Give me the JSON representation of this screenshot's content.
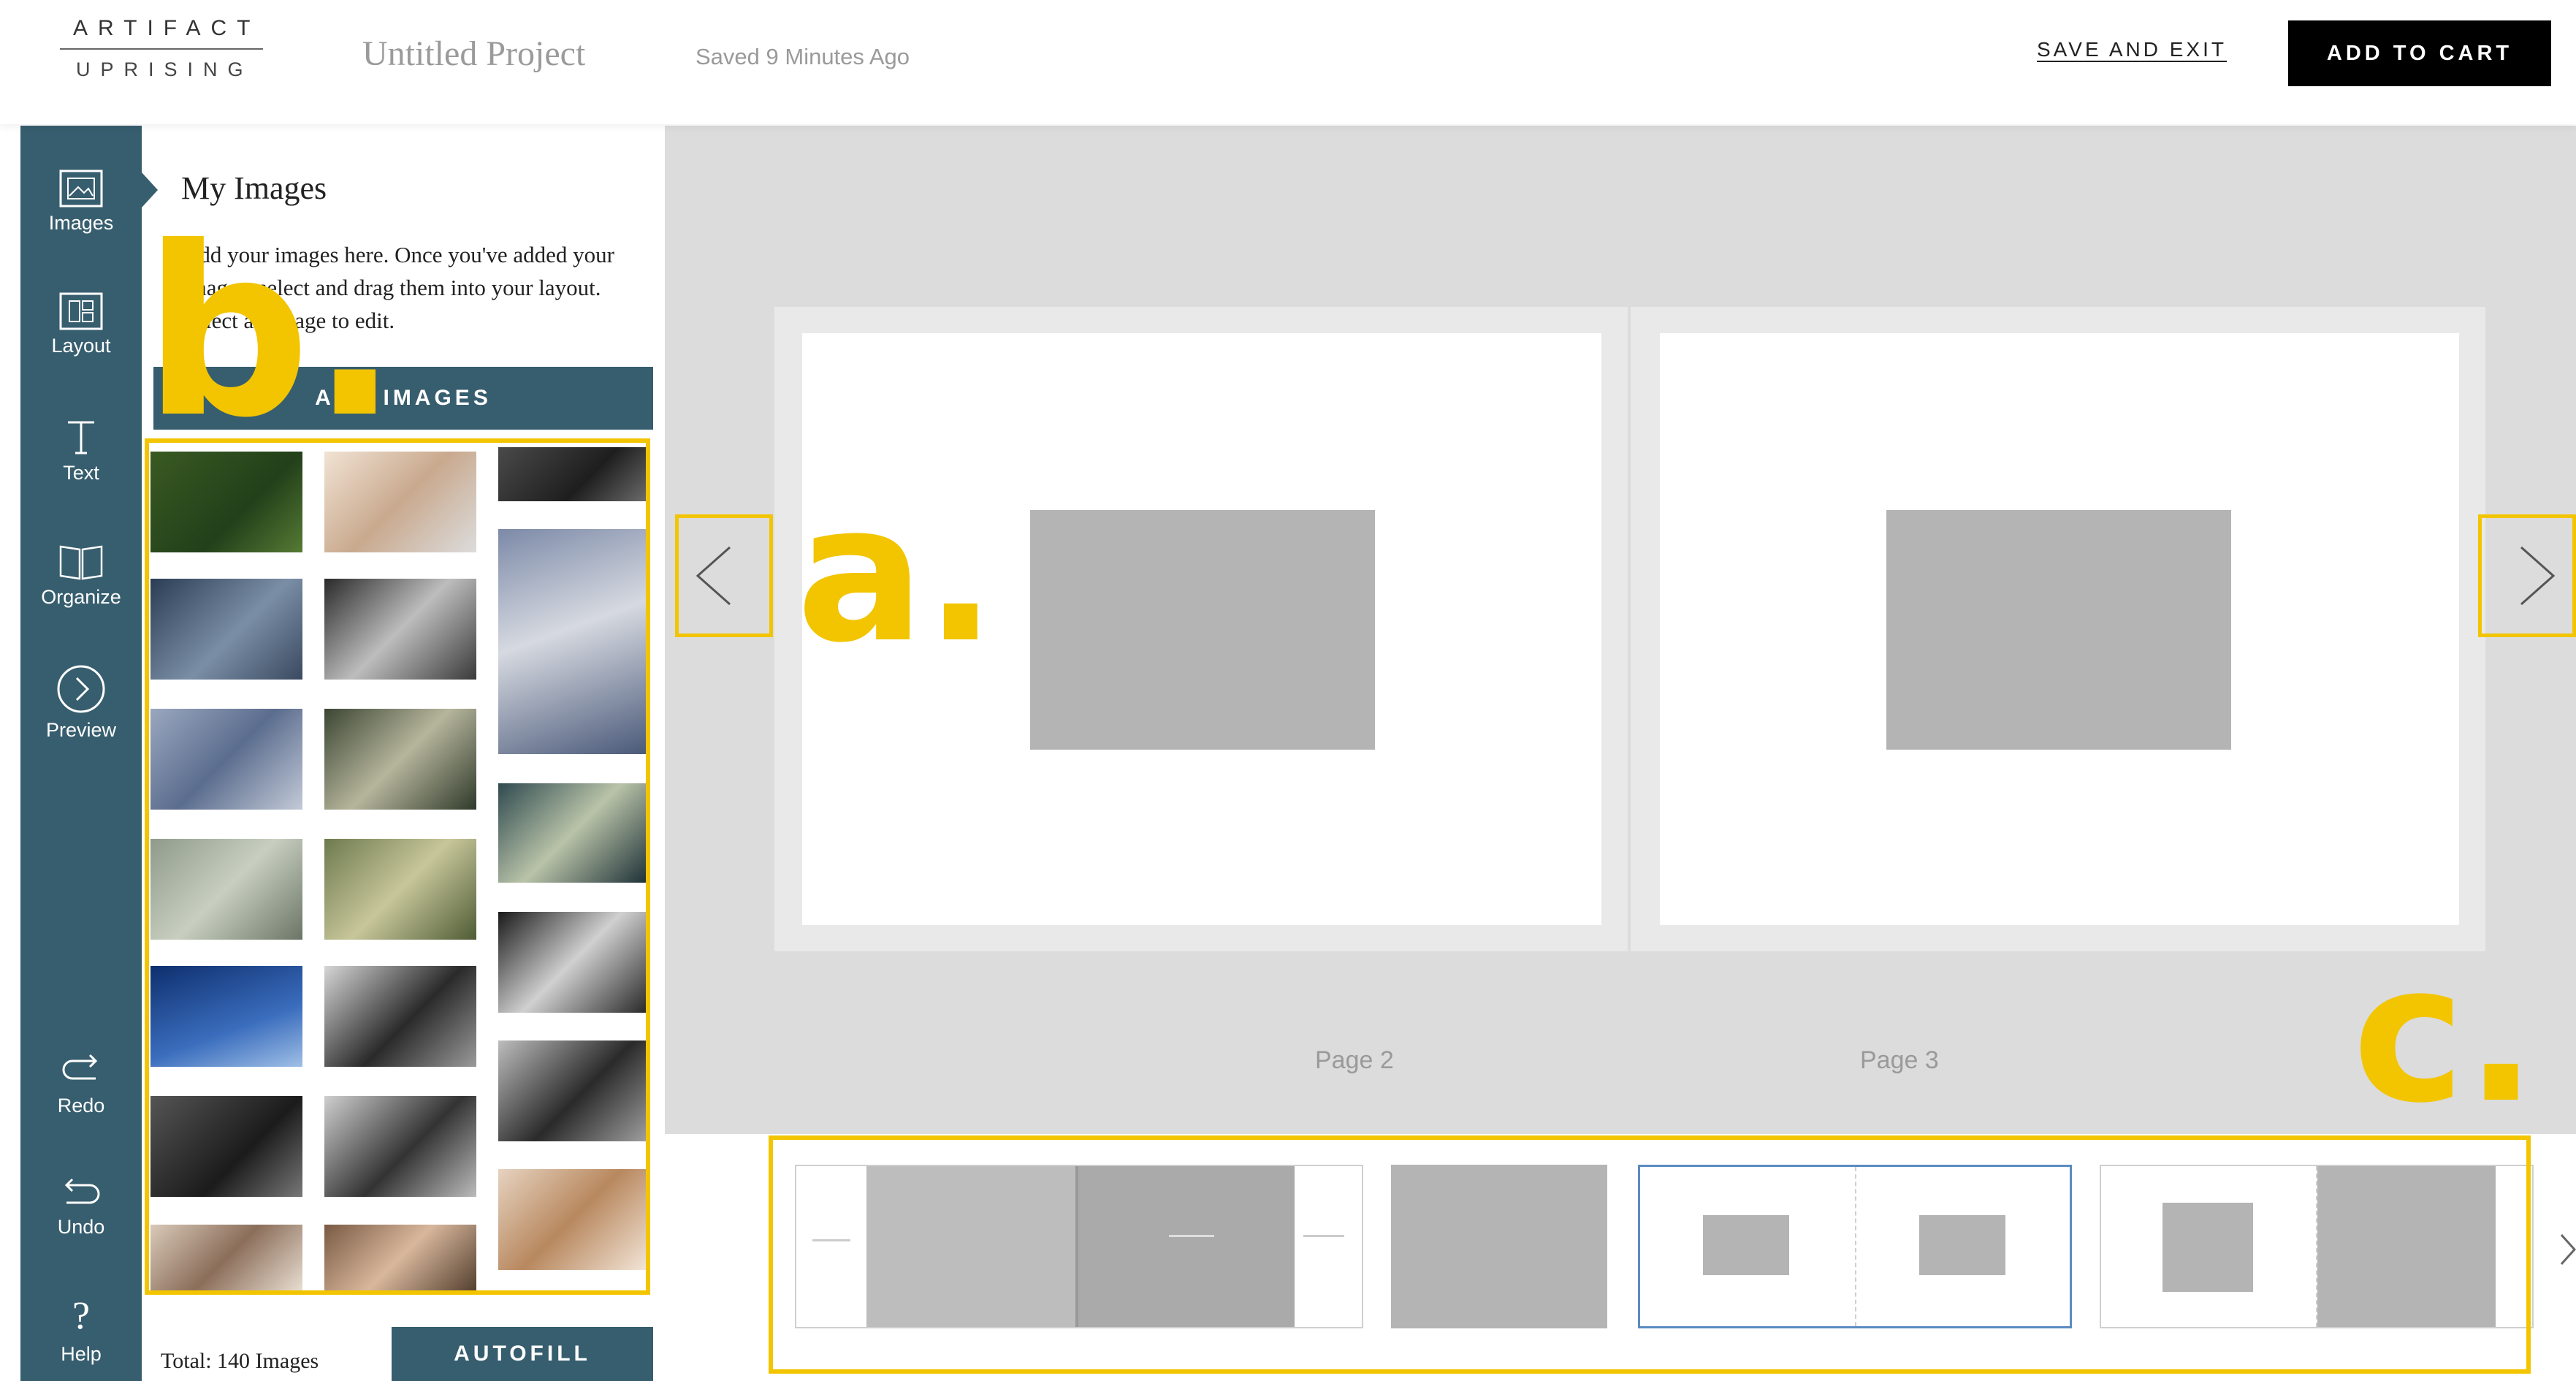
{
  "header": {
    "logo_line1": "ARTIFACT",
    "logo_line2": "UPRISING",
    "project_title": "Untitled Project",
    "saved_status": "Saved 9 Minutes Ago",
    "save_exit": "SAVE AND EXIT",
    "add_to_cart": "ADD TO CART"
  },
  "rail": {
    "tools": [
      {
        "label": "Images",
        "icon": "image-icon"
      },
      {
        "label": "Layout",
        "icon": "layout-icon"
      },
      {
        "label": "Text",
        "icon": "text-icon"
      },
      {
        "label": "Organize",
        "icon": "book-icon"
      },
      {
        "label": "Preview",
        "icon": "chevron-circle-icon"
      },
      {
        "label": "Redo",
        "icon": "redo-icon"
      },
      {
        "label": "Undo",
        "icon": "undo-icon"
      },
      {
        "label": "Help",
        "icon": "help-icon",
        "glyph": "?"
      }
    ]
  },
  "panel": {
    "title": "My Images",
    "description": "Add your images here. Once you've added your images, select and drag them into your layout. Select an image to edit.",
    "add_images": "ADD IMAGES",
    "total": "Total: 140 Images",
    "autofill": "AUTOFILL"
  },
  "canvas": {
    "left_page_label": "Page 2",
    "right_page_label": "Page 3"
  },
  "annotations": {
    "a": "a.",
    "b": "b.",
    "c": "c."
  },
  "colors": {
    "accent": "#375e6e",
    "highlight": "#f2c500",
    "canvas_bg": "#dcdcdc",
    "slot_gray": "#b4b4b4"
  }
}
